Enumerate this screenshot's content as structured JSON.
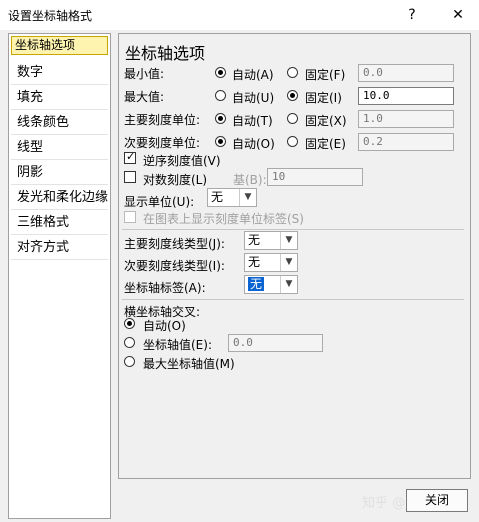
{
  "window": {
    "title": "设置坐标轴格式",
    "help": "?",
    "close": "✕"
  },
  "sidebar": {
    "items": [
      {
        "label": "坐标轴选项",
        "selected": true
      },
      {
        "label": "数字"
      },
      {
        "label": "填充"
      },
      {
        "label": "线条颜色"
      },
      {
        "label": "线型"
      },
      {
        "label": "阴影"
      },
      {
        "label": "发光和柔化边缘"
      },
      {
        "label": "三维格式"
      },
      {
        "label": "对齐方式"
      }
    ]
  },
  "panel": {
    "heading": "坐标轴选项",
    "rows": [
      {
        "label": "最小值:",
        "auto": "自动(A)",
        "fixed": "固定(F)",
        "value": "0.0",
        "selected": "auto"
      },
      {
        "label": "最大值:",
        "auto": "自动(U)",
        "fixed": "固定(I)",
        "value": "10.0",
        "selected": "fixed"
      },
      {
        "label": "主要刻度单位:",
        "auto": "自动(T)",
        "fixed": "固定(X)",
        "value": "1.0",
        "selected": "auto"
      },
      {
        "label": "次要刻度单位:",
        "auto": "自动(O)",
        "fixed": "固定(E)",
        "value": "0.2",
        "selected": "auto"
      }
    ],
    "reverse": "逆序刻度值(V)",
    "log": "对数刻度(L)",
    "log_base_label": "基(B):",
    "log_base_value": "10",
    "display_unit_label": "显示单位(U):",
    "display_unit_value": "无",
    "show_unit_label": "在图表上显示刻度单位标签(S)",
    "major_tick_label": "主要刻度线类型(J):",
    "major_tick_value": "无",
    "minor_tick_label": "次要刻度线类型(I):",
    "minor_tick_value": "无",
    "axis_label_label": "坐标轴标签(A):",
    "axis_label_value": "无",
    "cross_heading": "横坐标轴交叉:",
    "cross_auto": "自动(O)",
    "cross_value_label": "坐标轴值(E):",
    "cross_value": "0.0",
    "cross_max": "最大坐标轴值(M)"
  },
  "footer": {
    "close_label": "关闭",
    "watermark": "知乎 @夏天后"
  }
}
